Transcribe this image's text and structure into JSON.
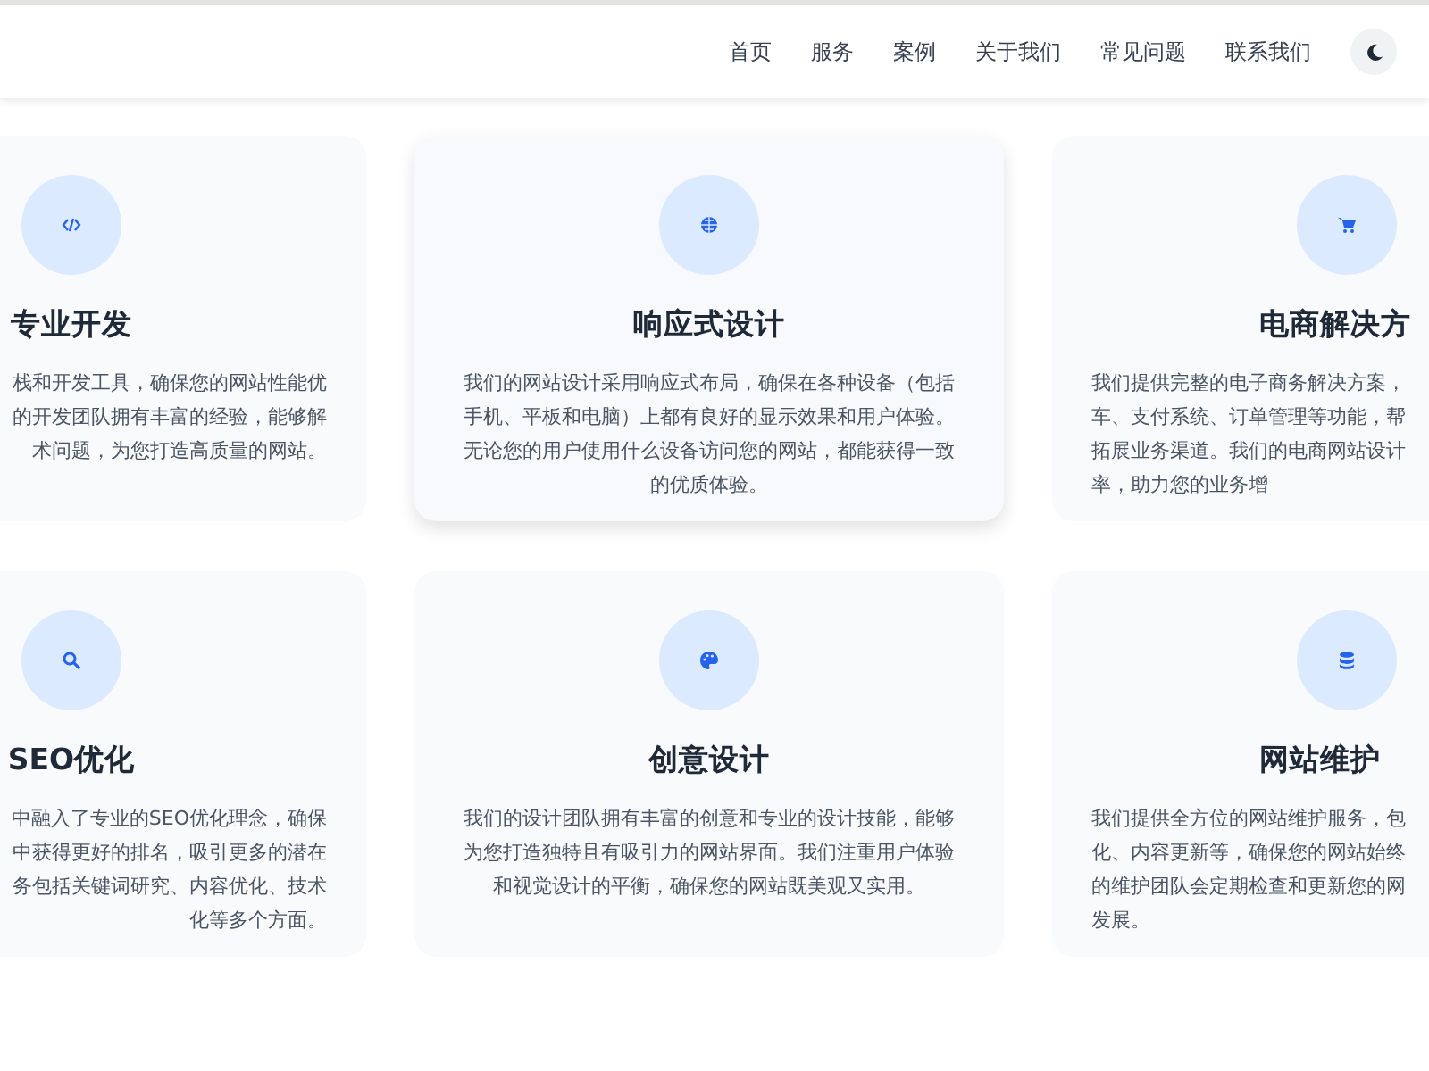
{
  "nav": {
    "links": [
      {
        "label": "首页"
      },
      {
        "label": "服务"
      },
      {
        "label": "案例"
      },
      {
        "label": "关于我们"
      },
      {
        "label": "常见问题"
      },
      {
        "label": "联系我们"
      }
    ]
  },
  "services": [
    {
      "kind": "cut-left",
      "highlighted": false,
      "title": "专业开发",
      "lines": [
        "栈和开发工具，确保您的网站性能优",
        "的开发团队拥有丰富的经验，能够解",
        "术问题，为您打造高质量的网站。"
      ]
    },
    {
      "kind": "full",
      "highlighted": true,
      "title": "响应式设计",
      "lines": [
        "我们的网站设计采用响应式布局，确保在各种设备（包括",
        "手机、平板和电脑）上都有良好的显示效果和用户体验。",
        "无论您的用户使用什么设备访问您的网站，都能获得一致",
        "的优质体验。"
      ]
    },
    {
      "kind": "cut-right",
      "highlighted": false,
      "title": "电商解决方",
      "lines": [
        "我们提供完整的电子商务解决方案，",
        "车、支付系统、订单管理等功能，帮",
        "拓展业务渠道。我们的电商网站设计",
        "率，助力您的业务增"
      ]
    },
    {
      "kind": "cut-left",
      "highlighted": false,
      "title": "SEO优化",
      "lines": [
        "中融入了专业的SEO优化理念，确保",
        "中获得更好的排名，吸引更多的潜在",
        "务包括关键词研究、内容优化、技术",
        "化等多个方面。"
      ]
    },
    {
      "kind": "full",
      "highlighted": false,
      "title": "创意设计",
      "lines": [
        "我们的设计团队拥有丰富的创意和专业的设计技能，能够",
        "为您打造独特且有吸引力的网站界面。我们注重用户体验",
        "和视觉设计的平衡，确保您的网站既美观又实用。"
      ]
    },
    {
      "kind": "cut-right",
      "highlighted": false,
      "title": "网站维护",
      "lines": [
        "我们提供全方位的网站维护服务，包",
        "化、内容更新等，确保您的网站始终",
        "的维护团队会定期检查和更新您的网",
        "发展。"
      ]
    }
  ]
}
